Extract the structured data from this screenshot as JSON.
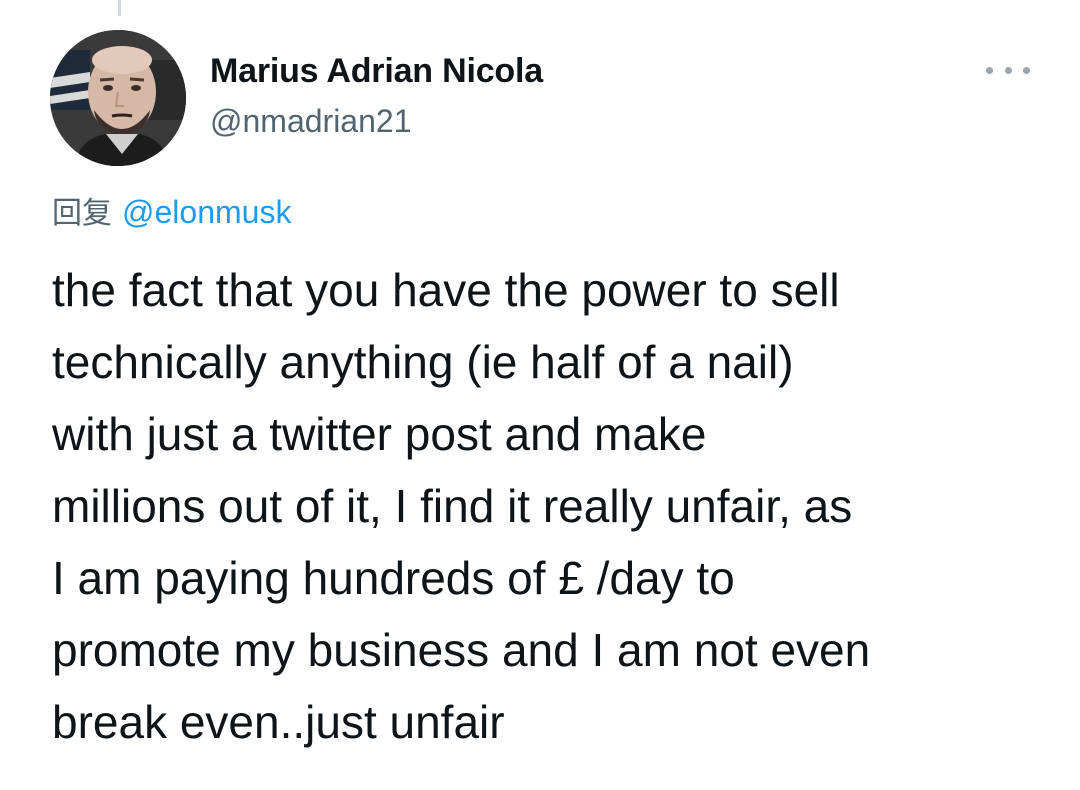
{
  "tweet": {
    "author": {
      "name": "Marius Adrian Nicola",
      "handle": "@nmadrian21",
      "avatar_icon": "profile-photo-icon"
    },
    "more_icon": "ellipsis-icon",
    "reply": {
      "prefix": "回复",
      "mention": "@elonmusk"
    },
    "text_lines": [
      "the fact that you have the power to sell",
      "technically anything (ie half of a nail)",
      "with just a twitter post and make",
      "millions out of it, I find it really unfair, as",
      "I am paying hundreds of £ /day to",
      "promote my business and I am not even",
      "break even..just unfair"
    ]
  },
  "colors": {
    "text": "#0f1419",
    "secondary": "#536471",
    "link": "#1d9bf0"
  }
}
